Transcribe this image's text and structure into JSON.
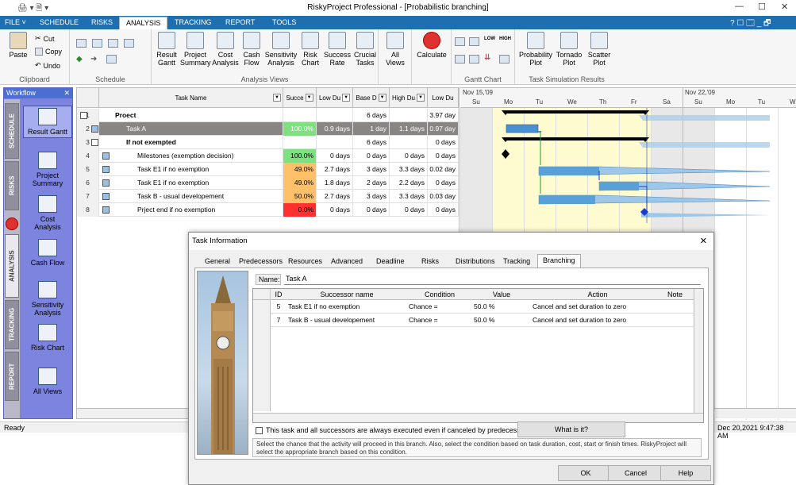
{
  "window": {
    "title": "RiskyProject Professional - [Probabilistic branching]",
    "minimize": "—",
    "maximize": "☐",
    "close": "✕"
  },
  "ribbon_tabs": [
    "FILE ˅",
    "SCHEDULE",
    "RISKS",
    "ANALYSIS",
    "TRACKING",
    "REPORT",
    "TOOLS"
  ],
  "ribbon_right": "? ☐ 🗔 _ 🗗",
  "clipboard": {
    "paste": "Paste",
    "cut": "Cut",
    "copy": "Copy",
    "undo": "Undo",
    "label": "Clipboard"
  },
  "schedule_label": "Schedule",
  "analysis_views": {
    "label": "Analysis Views",
    "buttons": [
      {
        "l1": "Result",
        "l2": "Gantt"
      },
      {
        "l1": "Project",
        "l2": "Summary"
      },
      {
        "l1": "Cost",
        "l2": "Analysis"
      },
      {
        "l1": "Cash",
        "l2": "Flow"
      },
      {
        "l1": "Sensitivity",
        "l2": "Analysis"
      },
      {
        "l1": "Risk",
        "l2": "Chart"
      },
      {
        "l1": "Success",
        "l2": "Rate"
      },
      {
        "l1": "Crucial",
        "l2": "Tasks"
      }
    ]
  },
  "all_views": {
    "l1": "All",
    "l2": "Views"
  },
  "calculate": "Calculate",
  "gantt_chart_label": "Gantt Chart",
  "gantt_low": "LOW",
  "gantt_high": "HIGH",
  "tsr": {
    "label": "Task Simulation Results",
    "buttons": [
      {
        "l1": "Probability",
        "l2": "Plot"
      },
      {
        "l1": "Tornado",
        "l2": "Plot"
      },
      {
        "l1": "Scatter",
        "l2": "Plot"
      }
    ]
  },
  "workflow": {
    "title": "Workflow",
    "close": "✕",
    "tabs": [
      "SCHEDULE",
      "RISKS",
      "ANALYSIS",
      "TRACKING",
      "REPORT"
    ],
    "items": [
      {
        "l1": "Result Gantt",
        "l2": ""
      },
      {
        "l1": "Project",
        "l2": "Summary"
      },
      {
        "l1": "Cost",
        "l2": "Analysis"
      },
      {
        "l1": "Cash Flow",
        "l2": ""
      },
      {
        "l1": "Sensitivity",
        "l2": "Analysis"
      },
      {
        "l1": "Risk Chart",
        "l2": ""
      },
      {
        "l1": "All Views",
        "l2": ""
      }
    ]
  },
  "grid": {
    "headers": [
      "Task Name",
      "Succe",
      "Low Du",
      "Base D",
      "High Du",
      "Low Du"
    ],
    "rows": [
      {
        "n": "1",
        "name": "Proect",
        "succ": "",
        "low": "",
        "base": "6 days",
        "high": "",
        "low2": "3.97 day"
      },
      {
        "n": "2",
        "name": "Task A",
        "succ": "100.0%",
        "low": "0.9 days",
        "base": "1 day",
        "high": "1.1 days",
        "low2": "0.97 day"
      },
      {
        "n": "3",
        "name": "If not exempted",
        "succ": "",
        "low": "",
        "base": "6 days",
        "high": "",
        "low2": "0 days"
      },
      {
        "n": "4",
        "name": "Milestones (exemption decision)",
        "succ": "100.0%",
        "low": "0 days",
        "base": "0 days",
        "high": "0 days",
        "low2": "0 days"
      },
      {
        "n": "5",
        "name": "Task E1 if no exemption",
        "succ": "49.0%",
        "low": "2.7 days",
        "base": "3 days",
        "high": "3.3 days",
        "low2": "0.02 day"
      },
      {
        "n": "6",
        "name": "Task E1 if no exemption",
        "succ": "49.0%",
        "low": "1.8 days",
        "base": "2 days",
        "high": "2.2 days",
        "low2": "0 days"
      },
      {
        "n": "7",
        "name": "Task B - usual developement",
        "succ": "50.0%",
        "low": "2.7 days",
        "base": "3 days",
        "high": "3.3 days",
        "low2": "0.03 day"
      },
      {
        "n": "8",
        "name": "Prject end if no exemption",
        "succ": "0.0%",
        "low": "0 days",
        "base": "0 days",
        "high": "0 days",
        "low2": "0 days"
      }
    ]
  },
  "gantt": {
    "week1": "Nov 15,'09",
    "week2": "Nov 22,'09",
    "days": [
      "Su",
      "Mo",
      "Tu",
      "We",
      "Th",
      "Fr",
      "Sa",
      "Su",
      "Mo",
      "Tu",
      "W"
    ]
  },
  "dialog": {
    "title": "Task Information",
    "close": "✕",
    "tabs": [
      "General",
      "Predecessors",
      "Resources",
      "Advanced",
      "Deadline",
      "Risks",
      "Distributions",
      "Tracking",
      "Branching"
    ],
    "name_label": "Name:",
    "name_value": "Task A",
    "headers": [
      "ID",
      "Successor name",
      "Condition",
      "Value",
      "Action",
      "Note"
    ],
    "rows": [
      {
        "n": "1",
        "id": "5",
        "name": "Task E1 if no exemption",
        "cond": "Chance =",
        "val": "50.0 %",
        "action": "Cancel and set duration to zero"
      },
      {
        "n": "2",
        "id": "7",
        "name": "Task B - usual developement",
        "cond": "Chance =",
        "val": "50.0 %",
        "action": "Cancel and set duration to zero"
      }
    ],
    "checkbox": "This task and all successors are always executed even if canceled by predecessors",
    "whatis": "What is it?",
    "help": "Select the chance that the activity will proceed in this branch. Also, select the condition based on task duration, cost, start or finish times. RiskyProject will select the appropriate branch based on this condition.",
    "ok": "OK",
    "cancel": "Cancel",
    "helpbtn": "Help"
  },
  "status": {
    "left": "Ready",
    "right": "Dec 20,2021 9:47:38 AM"
  },
  "colors": {
    "ribbon": "#1e6fb0",
    "workflow": "#7c84e0",
    "green": "#7fe07f",
    "orange": "#ffc06a",
    "red": "#ff3030"
  }
}
